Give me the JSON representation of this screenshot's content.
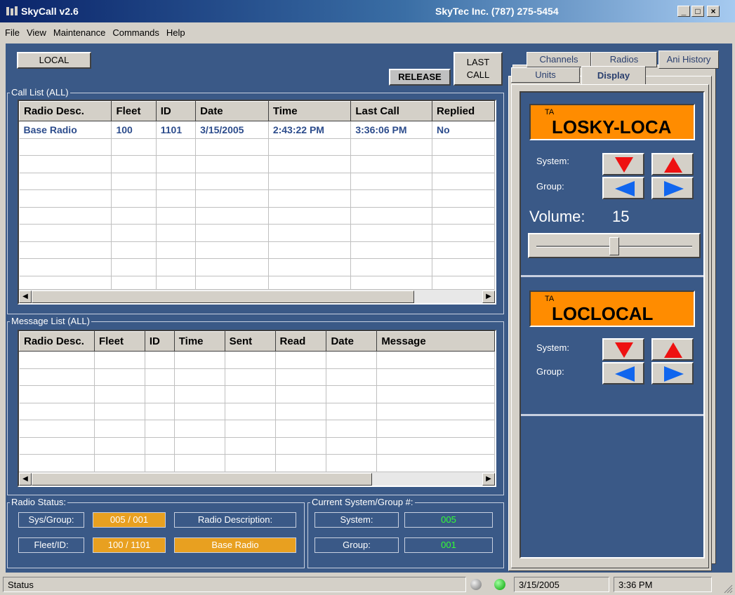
{
  "window": {
    "title": "SkyCall v2.6",
    "company": "SkyTec Inc. (787) 275-5454",
    "buttons": {
      "minimize": "_",
      "maximize": "□",
      "close": "×"
    }
  },
  "menu": [
    "File",
    "View",
    "Maintenance",
    "Commands",
    "Help"
  ],
  "toolbar": {
    "local": "LOCAL",
    "release": "RELEASE",
    "last_call_1": "LAST",
    "last_call_2": "CALL"
  },
  "call_list": {
    "label": "Call List (ALL)",
    "columns": [
      "Radio Desc.",
      "Fleet",
      "ID",
      "Date",
      "Time",
      "Last Call",
      "Replied"
    ],
    "rows": [
      [
        "Base Radio",
        "100",
        "1101",
        "3/15/2005",
        "2:43:22 PM",
        "3:36:06 PM",
        "No"
      ]
    ]
  },
  "message_list": {
    "label": "Message List (ALL)",
    "columns": [
      "Radio Desc.",
      "Fleet",
      "ID",
      "Time",
      "Sent",
      "Read",
      "Date",
      "Message"
    ]
  },
  "radio_status": {
    "label": "Radio Status:",
    "sys_group_label": "Sys/Group:",
    "sys_group_value": "005 / 001",
    "radio_desc_label": "Radio Description:",
    "fleet_id_label": "Fleet/ID:",
    "fleet_id_value": "100 / 1101",
    "radio_desc_value": "Base Radio"
  },
  "current_system": {
    "label": "Current System/Group #:",
    "system_label": "System:",
    "system_value": "005",
    "group_label": "Group:",
    "group_value": "001"
  },
  "tabs": {
    "channels": "Channels",
    "radios": "Radios",
    "ani_history": "Ani History",
    "units": "Units",
    "display": "Display"
  },
  "display": {
    "lcd1_small": "TA",
    "lcd1_big": "LOSKY-LOCA",
    "lcd2_small": "TA",
    "lcd2_big": "LOCLOCAL",
    "system_label": "System:",
    "group_label": "Group:",
    "volume_label": "Volume:",
    "volume_value": "15",
    "volume_level": 0.5
  },
  "statusbar": {
    "status": "Status",
    "date": "3/15/2005",
    "time": "3:36 PM"
  },
  "colors": {
    "panel_bg": "#3a5987",
    "lcd": "#ff8c00",
    "status_value": "#e8a020",
    "green_text": "#33ff33",
    "grid_text": "#2c4c8c"
  }
}
